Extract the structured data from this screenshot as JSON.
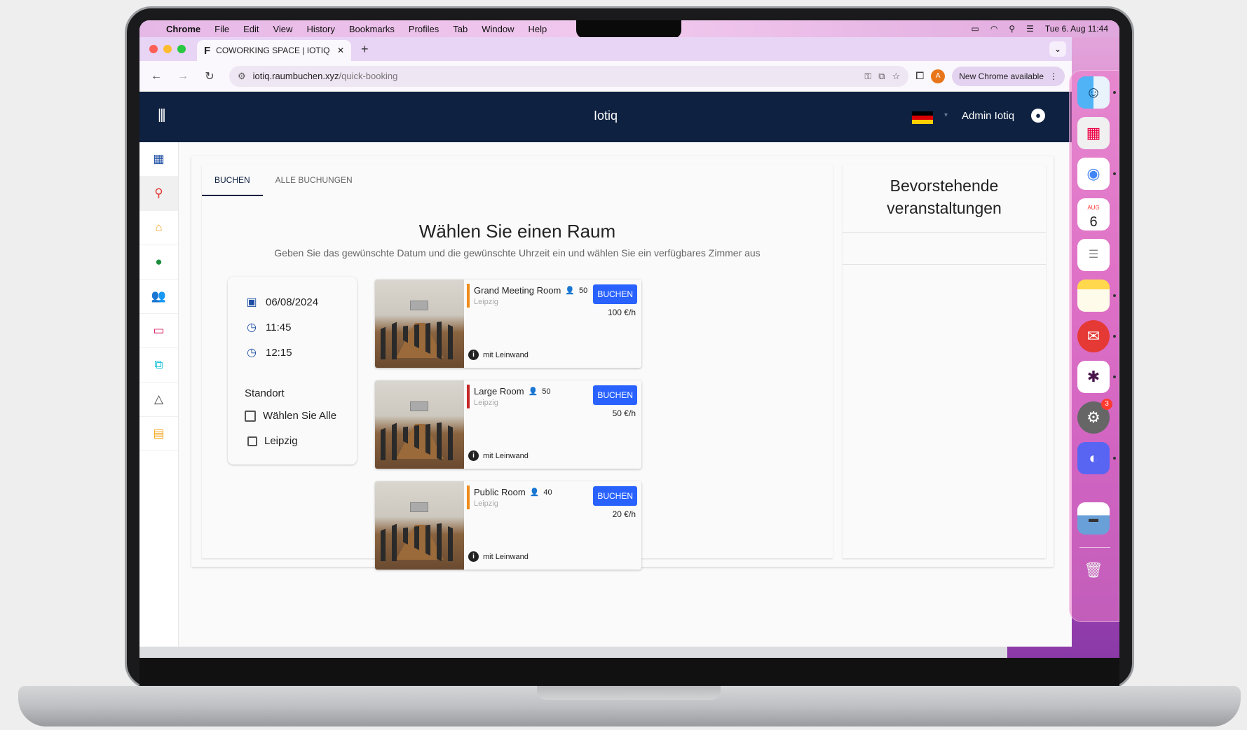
{
  "menubar": {
    "apple": "",
    "app": "Chrome",
    "items": [
      "File",
      "Edit",
      "View",
      "History",
      "Bookmarks",
      "Profiles",
      "Tab",
      "Window",
      "Help"
    ],
    "datetime": "Tue 6. Aug  11:44"
  },
  "browser": {
    "tab_title": "COWORKING SPACE | IOTIQ",
    "tab_favicon": "F",
    "url_domain": "iotiq.raumbuchen.xyz",
    "url_path": "/quick-booking",
    "update_chip": "New Chrome available",
    "profile_initial": "A"
  },
  "app": {
    "title": "Iotiq",
    "user": "Admin Iotiq",
    "language_flag": "de"
  },
  "sidebar": {
    "items": [
      {
        "icon": "dashboard-icon",
        "glyph": "▦",
        "color": "#1e4fa3"
      },
      {
        "icon": "search-icon",
        "glyph": "⚲",
        "color": "#e53935"
      },
      {
        "icon": "home-icon",
        "glyph": "⌂",
        "color": "#f5a623"
      },
      {
        "icon": "location-pin-icon",
        "glyph": "●",
        "color": "#1e8e3e"
      },
      {
        "icon": "people-icon",
        "glyph": "👥",
        "color": "#111"
      },
      {
        "icon": "devices-icon",
        "glyph": "▭",
        "color": "#d81b60"
      },
      {
        "icon": "layers-icon",
        "glyph": "⧉",
        "color": "#26c6da"
      },
      {
        "icon": "shapes-icon",
        "glyph": "△",
        "color": "#444"
      },
      {
        "icon": "calendar-icon",
        "glyph": "▤",
        "color": "#f5a623"
      }
    ]
  },
  "tabs": {
    "book": "BUCHEN",
    "all_bookings": "ALLE BUCHUNGEN"
  },
  "main": {
    "heading": "Wählen Sie einen Raum",
    "subheading": "Geben Sie das gewünschte Datum und die gewünschte Uhrzeit ein und wählen Sie ein verfügbares Zimmer aus"
  },
  "filter": {
    "date": "06/08/2024",
    "start_time": "11:45",
    "end_time": "12:15",
    "location_label": "Standort",
    "select_all": "Wählen Sie Alle",
    "location_option": "Leipzig"
  },
  "rooms": [
    {
      "name": "Grand Meeting Room",
      "capacity": "50",
      "location": "Leipzig",
      "book": "BUCHEN",
      "price": "100 €/h",
      "feature": "mit Leinwand",
      "accent": "#f08c1a"
    },
    {
      "name": "Large Room",
      "capacity": "50",
      "location": "Leipzig",
      "book": "BUCHEN",
      "price": "50 €/h",
      "feature": "mit Leinwand",
      "accent": "#c62828"
    },
    {
      "name": "Public Room",
      "capacity": "40",
      "location": "Leipzig",
      "book": "BUCHEN",
      "price": "20 €/h",
      "feature": "mit Leinwand",
      "accent": "#f08c1a"
    }
  ],
  "upcoming": {
    "title_line1": "Bevorstehende",
    "title_line2": "veranstaltungen"
  },
  "dock": {
    "calendar_month": "AUG",
    "calendar_day": "6",
    "settings_badge": "3"
  }
}
